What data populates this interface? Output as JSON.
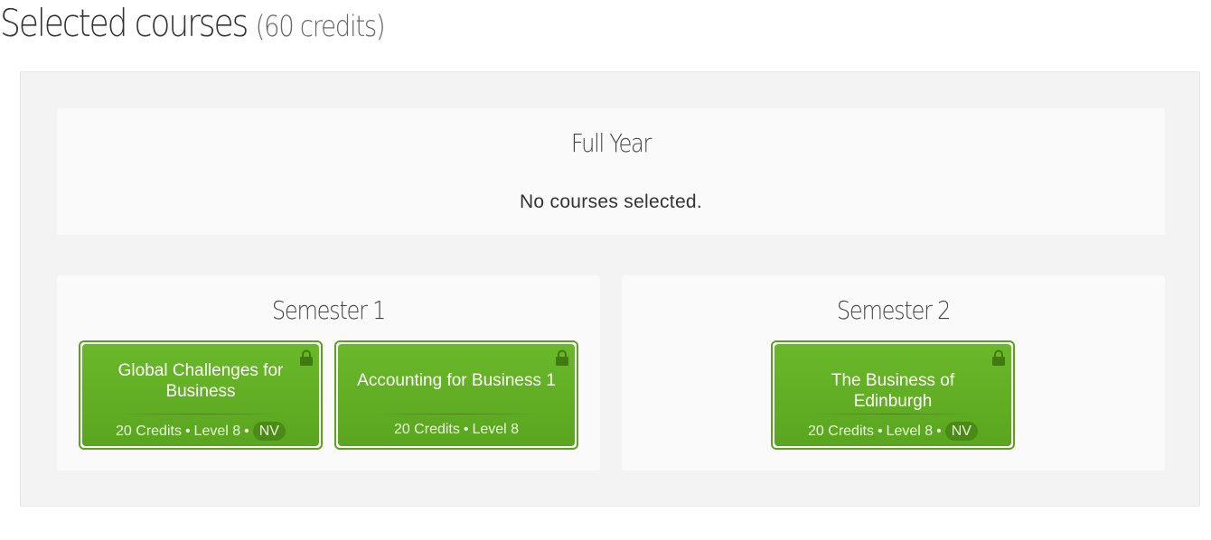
{
  "header": {
    "title": "Selected courses",
    "credits": "(60 credits)"
  },
  "full_year": {
    "heading": "Full Year",
    "empty_message": "No courses selected."
  },
  "semester1": {
    "heading": "Semester 1",
    "courses": [
      {
        "title": "Global Challenges for Business",
        "credits": "20 Credits",
        "level": "Level 8",
        "badge": "NV",
        "locked": true
      },
      {
        "title": "Accounting for Business 1",
        "credits": "20 Credits",
        "level": "Level 8",
        "locked": true
      }
    ]
  },
  "semester2": {
    "heading": "Semester 2",
    "courses": [
      {
        "title": "The Business of Edinburgh",
        "credits": "20 Credits",
        "level": "Level 8",
        "badge": "NV",
        "locked": true
      }
    ]
  },
  "colors": {
    "card_green": "#62ad25",
    "card_border": "#5aa11d",
    "badge_green": "#4a8a17",
    "lock_icon": "#3f7a12"
  },
  "separator": "•",
  "icons": {
    "lock": "lock-icon"
  }
}
